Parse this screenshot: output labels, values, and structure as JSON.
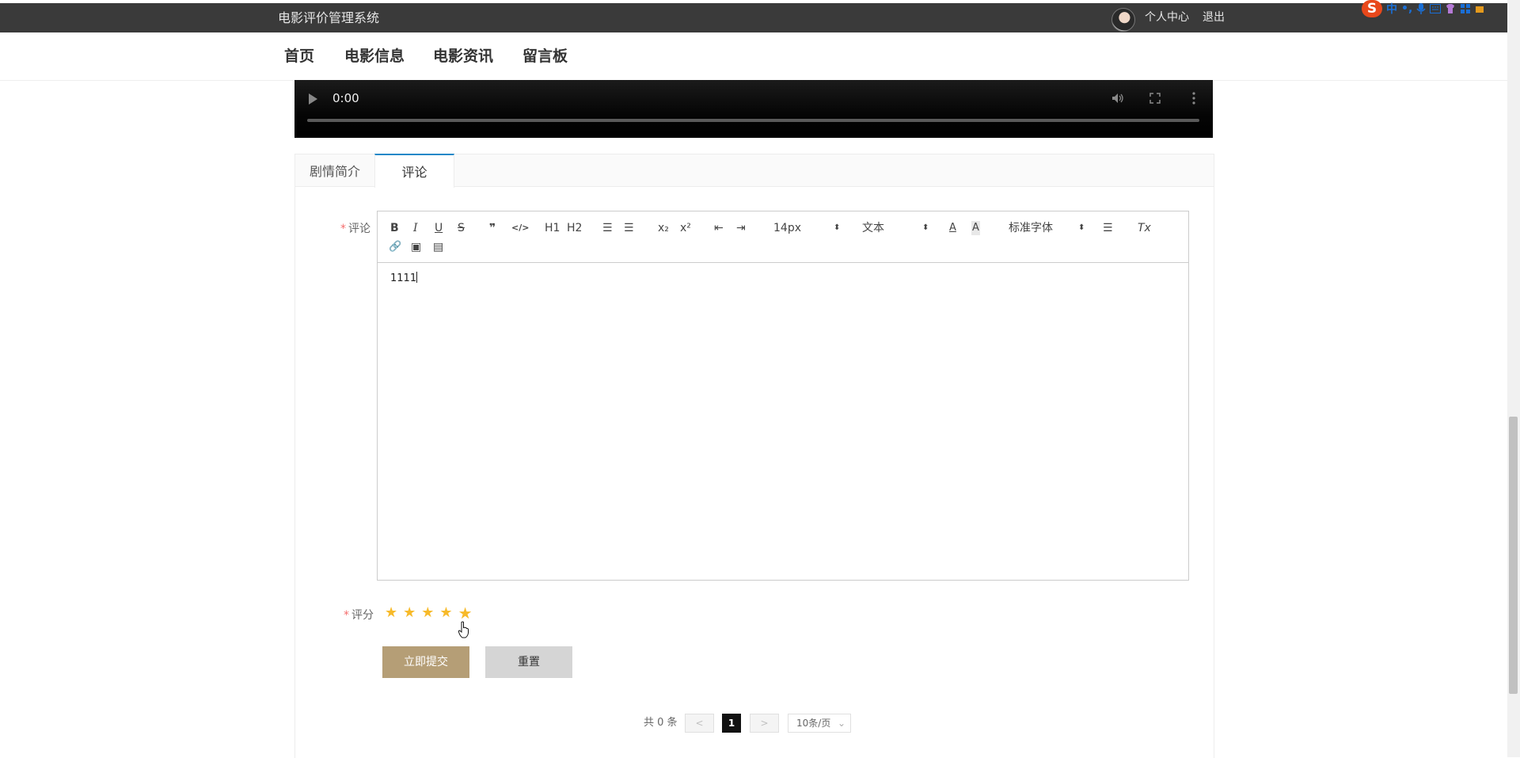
{
  "header": {
    "brand": "电影评价管理系统",
    "personal_center": "个人中心",
    "logout": "退出",
    "ime": {
      "logo": "S",
      "mode": "中",
      "punct": "•,"
    }
  },
  "nav": {
    "items": [
      "首页",
      "电影信息",
      "电影资讯",
      "留言板"
    ]
  },
  "video": {
    "time": "0:00",
    "progress": 0
  },
  "tabs": [
    {
      "label": "剧情简介",
      "active": false
    },
    {
      "label": "评论",
      "active": true
    }
  ],
  "form": {
    "comment_label": "评论",
    "required_mark": "*",
    "rating_label": "评分",
    "rating_value": 5,
    "rating_max": 5,
    "submit_label": "立即提交",
    "reset_label": "重置"
  },
  "editor": {
    "toolbar": {
      "bold": "B",
      "italic": "I",
      "underline": "U",
      "strike": "S",
      "quote": "❞",
      "code": "</>",
      "h1": "H1",
      "h2": "H2",
      "ordered_list": "☰",
      "bullet_list": "☰",
      "subscript": "x₂",
      "superscript": "x²",
      "outdent": "⇤",
      "indent": "⇥",
      "size": "14px",
      "format": "文本",
      "color": "A",
      "background": "A",
      "font": "标准字体",
      "align": "☰",
      "clean": "Tx",
      "link": "🔗",
      "image": "▣",
      "video": "▤"
    },
    "content": "1111"
  },
  "pagination": {
    "total": "共 0 条",
    "prev": "<",
    "page": "1",
    "next": ">",
    "page_size": "10条/页"
  },
  "colors": {
    "accent": "#b59e76",
    "star": "#f7ba2a",
    "tab_active": "#1e88c8",
    "topbar": "#3a3a3a"
  }
}
